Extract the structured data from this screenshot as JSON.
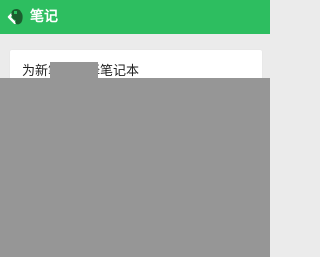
{
  "header": {
    "title": "笔记",
    "back_icon": "chevron-left-icon",
    "logo_icon": "evernote-elephant-icon",
    "bg_color": "#2dbe60"
  },
  "card": {
    "label": "为新笔记选择笔记本"
  },
  "overlay": {
    "color": "#969696"
  }
}
